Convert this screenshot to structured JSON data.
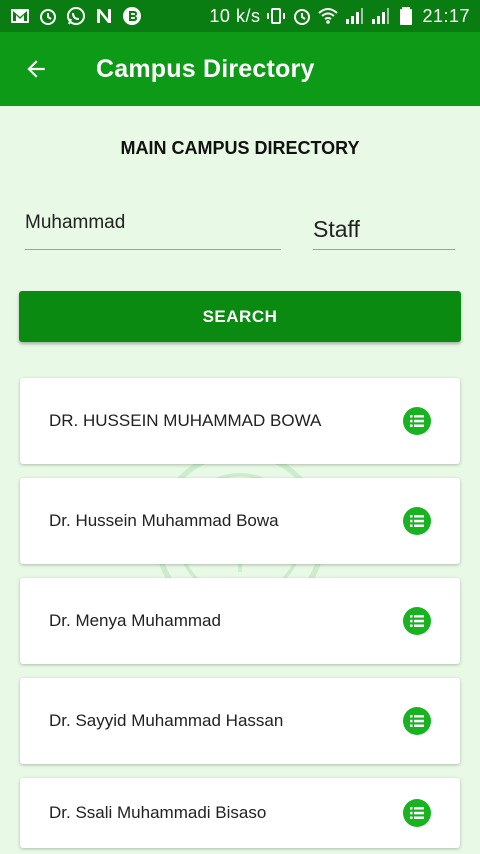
{
  "status_bar": {
    "left_icons": [
      "gmail-icon",
      "alarm-icon",
      "whatsapp-icon",
      "n-app-icon",
      "bitcoin-icon"
    ],
    "net_speed": "10 k/s",
    "right_icons": [
      "vibrate-icon",
      "alarm-icon",
      "wifi-icon",
      "signal-icon",
      "signal-icon",
      "battery-icon"
    ],
    "time": "21:17"
  },
  "app_bar": {
    "back_icon": "arrow-left-icon",
    "title": "Campus Directory",
    "color": "#0d9a16"
  },
  "main": {
    "heading": "MAIN CAMPUS DIRECTORY",
    "search_value": "Muhammad",
    "category_value": "Staff",
    "search_button": "SEARCH",
    "results": [
      {
        "name": "DR. HUSSEIN MUHAMMAD BOWA"
      },
      {
        "name": "Dr. Hussein Muhammad Bowa"
      },
      {
        "name": "Dr. Menya Muhammad"
      },
      {
        "name": "Dr. Sayyid Muhammad Hassan"
      },
      {
        "name": "Dr. Ssali Muhammadi Bisaso"
      }
    ],
    "result_icon": "list-icon",
    "accent": "#18b321"
  }
}
